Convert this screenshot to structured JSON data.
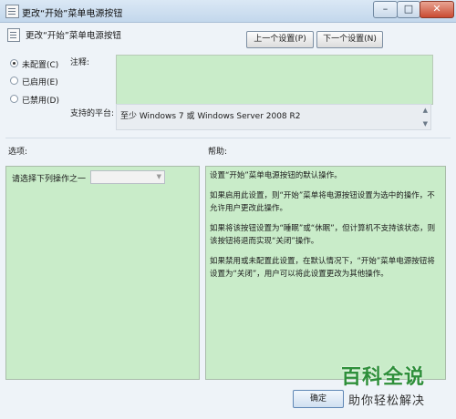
{
  "window": {
    "title": "更改“开始”菜单电源按钮",
    "minimize_glyph": "–",
    "maximize_glyph": "□",
    "close_glyph": "✕"
  },
  "header": {
    "title": "更改“开始”菜单电源按钮",
    "prev_label": "上一个设置(P)",
    "next_label": "下一个设置(N)"
  },
  "state_options": [
    {
      "label": "未配置(C)",
      "selected": true
    },
    {
      "label": "已启用(E)",
      "selected": false
    },
    {
      "label": "已禁用(D)",
      "selected": false
    }
  ],
  "comment": {
    "label": "注释:",
    "value": ""
  },
  "platform": {
    "label": "支持的平台:",
    "value": "至少 Windows 7 或 Windows Server 2008 R2"
  },
  "options": {
    "section_label": "选项:",
    "action_label": "请选择下列操作之一",
    "action_value": ""
  },
  "help": {
    "section_label": "帮助:",
    "paragraphs": [
      "设置“开始”菜单电源按钮的默认操作。",
      "如果启用此设置，则“开始”菜单将电源按钮设置为选中的操作，不允许用户更改此操作。",
      "如果将该按钮设置为“睡眠”或“休眠”，但计算机不支持该状态，则该按钮将退而实现“关闭”操作。",
      "如果禁用或未配置此设置，在默认情况下，“开始”菜单电源按钮将设置为“关闭”，用户可以将此设置更改为其他操作。"
    ]
  },
  "footer": {
    "ok_label": "确定"
  },
  "watermark": {
    "big": "百科全说",
    "small": "助你轻松解决"
  },
  "colors": {
    "panel_green": "#c9ecc9",
    "window_bg": "#eef3f8",
    "watermark_green": "#2e8f3a"
  }
}
